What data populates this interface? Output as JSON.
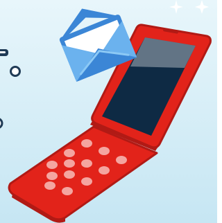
{
  "scene": {
    "subject": "flip-phone-with-envelope",
    "icons": [
      "flip-phone-icon",
      "envelope-icon",
      "sparkle-icon"
    ],
    "colors": {
      "background_top": "#e8f6fb",
      "background_bottom": "#c6e6f3",
      "phone_body": "#e2231a",
      "phone_outline": "#b11a15",
      "phone_screen": "#0e2a44",
      "phone_keys": "#f4a5a0",
      "envelope_blue": "#3b86d6",
      "envelope_light": "#6bb2ee",
      "envelope_paper": "#ffffff",
      "ring_outline": "#1f3b56",
      "sparkle": "#ffffff"
    }
  }
}
